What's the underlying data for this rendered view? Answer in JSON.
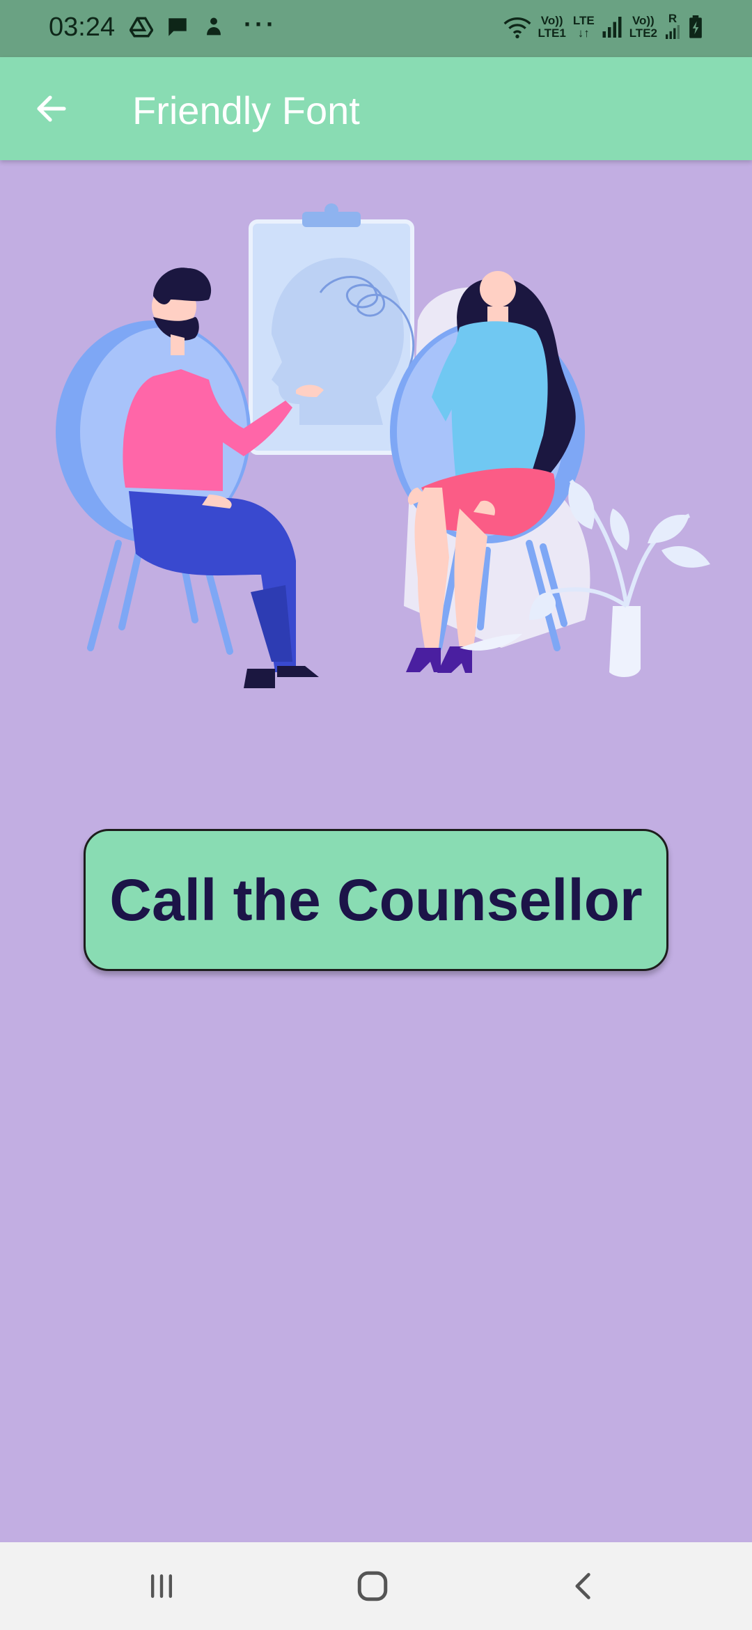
{
  "status_bar": {
    "time": "03:24",
    "left_icons": [
      "drive-icon",
      "message-icon",
      "app-notification-icon"
    ],
    "more": "···",
    "sim1_top": "Vo))",
    "sim1_bottom": "LTE1",
    "lte_label": "LTE",
    "sim2_top": "Vo))",
    "sim2_bottom": "LTE2",
    "roaming": "R"
  },
  "app_bar": {
    "title": "Friendly Font",
    "back_icon": "arrow-left-icon"
  },
  "main": {
    "illustration": "counselling-session-illustration",
    "call_button_label": "Call the Counsellor"
  },
  "nav_bar": {
    "recents_icon": "recents-icon",
    "home_icon": "home-icon",
    "back_icon": "back-chevron-icon"
  },
  "colors": {
    "status_bar_bg": "#6aa283",
    "app_bar_bg": "#89dcb3",
    "page_bg": "#c2aee2",
    "button_text": "#1c1448",
    "nav_bar_bg": "#f2f2f2"
  }
}
